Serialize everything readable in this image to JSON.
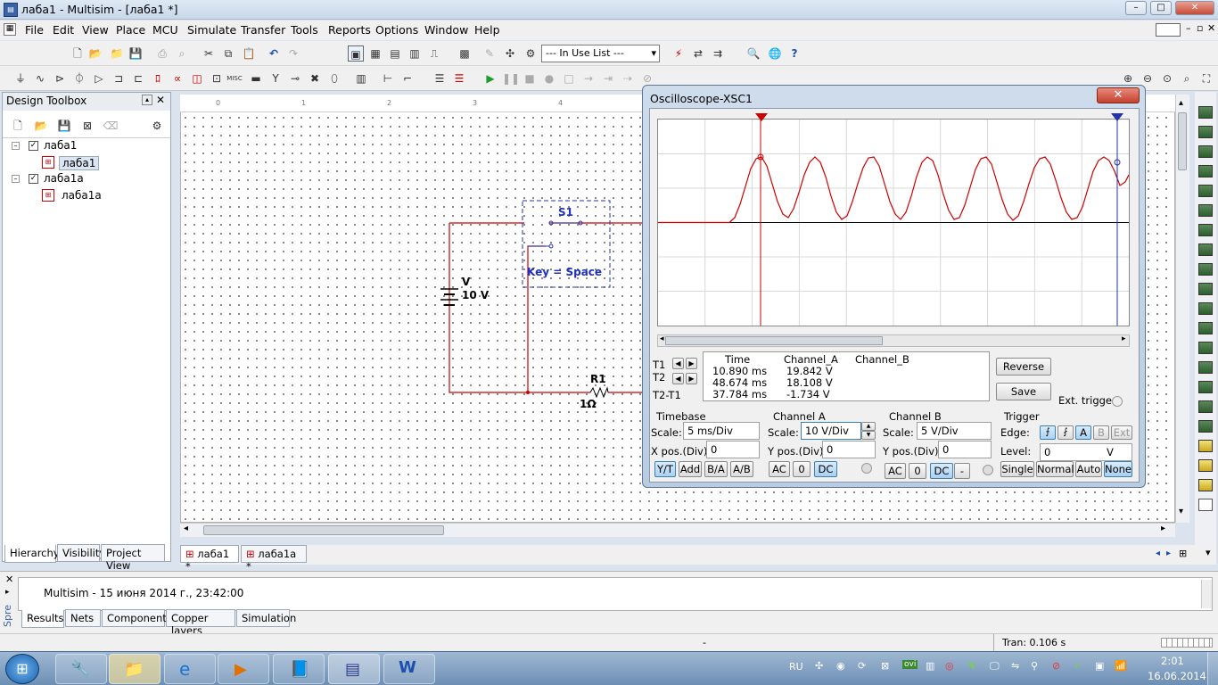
{
  "window": {
    "title": "лаба1 - Multisim - [лаба1 *]",
    "min": "–",
    "max": "□",
    "close": "✕"
  },
  "menu": [
    "File",
    "Edit",
    "View",
    "Place",
    "MCU",
    "Simulate",
    "Transfer",
    "Tools",
    "Reports",
    "Options",
    "Window",
    "Help"
  ],
  "toolbar": {
    "in_use_list": "--- In Use List ---",
    "misc_label": "MISC"
  },
  "design_toolbox": {
    "title": "Design Toolbox",
    "tree": [
      {
        "label": "лаба1",
        "child": "лаба1"
      },
      {
        "label": "лаба1а",
        "child": "лаба1а"
      }
    ],
    "tabs": [
      "Hierarchy",
      "Visibility",
      "Project View"
    ]
  },
  "ruler": [
    "0",
    "1",
    "2",
    "3",
    "4"
  ],
  "schematic": {
    "switch_name": "S1",
    "switch_key": "Key = Space",
    "source_name": "V",
    "source_value": "10 V",
    "resistor_name": "R1",
    "resistor_value": "1Ω"
  },
  "doc_tabs": [
    "лаба1 *",
    "лаба1а *"
  ],
  "oscilloscope": {
    "title": "Oscilloscope-XSC1",
    "cursor_table": {
      "headers": [
        "Time",
        "Channel_A",
        "Channel_B"
      ],
      "rows": [
        {
          "label": "T1",
          "time": "10.890 ms",
          "a": "19.842 V",
          "b": ""
        },
        {
          "label": "T2",
          "time": "48.674 ms",
          "a": "18.108 V",
          "b": ""
        },
        {
          "label": "T2-T1",
          "time": "37.784 ms",
          "a": "-1.734 V",
          "b": ""
        }
      ]
    },
    "buttons": {
      "reverse": "Reverse",
      "save": "Save",
      "ext_trigger": "Ext. trigger"
    },
    "timebase": {
      "title": "Timebase",
      "scale_label": "Scale:",
      "scale": "5 ms/Div",
      "xpos_label": "X pos.(Div):",
      "xpos": "0",
      "modes": [
        "Y/T",
        "Add",
        "B/A",
        "A/B"
      ]
    },
    "channel_a": {
      "title": "Channel A",
      "scale_label": "Scale:",
      "scale": "10  V/Div",
      "ypos_label": "Y pos.(Div):",
      "ypos": "0",
      "coupling": [
        "AC",
        "0",
        "DC"
      ]
    },
    "channel_b": {
      "title": "Channel B",
      "scale_label": "Scale:",
      "scale": "5  V/Div",
      "ypos_label": "Y pos.(Div):",
      "ypos": "0",
      "coupling": [
        "AC",
        "0",
        "DC",
        "-"
      ]
    },
    "trigger": {
      "title": "Trigger",
      "edge_label": "Edge:",
      "sources": [
        "A",
        "B",
        "Ext"
      ],
      "level_label": "Level:",
      "level": "0",
      "level_unit": "V",
      "modes": [
        "Single",
        "Normal",
        "Auto",
        "None"
      ]
    }
  },
  "results": {
    "message": "Multisim  -  15 июня 2014 г., 23:42:00",
    "side_label": "Spre",
    "tabs": [
      "Results",
      "Nets",
      "Components",
      "Copper layers",
      "Simulation"
    ]
  },
  "statusbar": {
    "dash": "-",
    "tran": "Tran: 0.106 s"
  },
  "taskbar": {
    "lang": "RU",
    "time": "2:01",
    "date": "16.06.2014",
    "tray_badge": "ovi"
  },
  "colors": {
    "wire": "#cc0000",
    "trace": "#cc0000",
    "cursor1": "#cc0000",
    "cursor2": "#2233aa",
    "label": "#1f2fbf"
  }
}
